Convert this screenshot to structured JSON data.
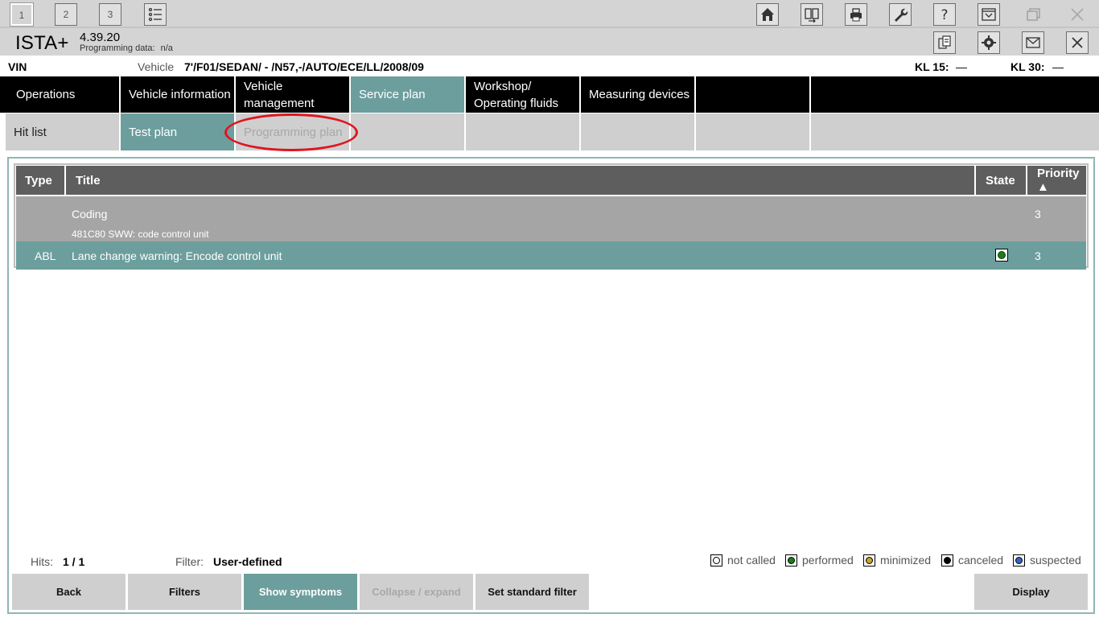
{
  "workspace_tabs": [
    "1",
    "2",
    "3"
  ],
  "toolbar_icons": [
    "list-icon",
    "home-icon",
    "swap-icon",
    "print-icon",
    "wrench-icon",
    "help-icon",
    "minimize-icon",
    "restore-icon",
    "close-icon"
  ],
  "header": {
    "brand": "ISTA+",
    "version": "4.39.20",
    "programming_label": "Programming data:",
    "programming_value": "n/a"
  },
  "vehicle_line": {
    "vin_label": "VIN",
    "vehicle_label": "Vehicle",
    "vehicle_value": "7'/F01/SEDAN/ - /N57,-/AUTO/ECE/LL/2008/09",
    "kl15_label": "KL 15:",
    "kl15_value": "—",
    "kl30_label": "KL 30:",
    "kl30_value": "—"
  },
  "main_nav": [
    "Operations",
    "Vehicle information",
    "Vehicle management",
    "Service plan",
    "Workshop/ Operating fluids",
    "Measuring devices"
  ],
  "main_nav_selected": "Service plan",
  "sub_nav": [
    "Hit list",
    "Test plan",
    "Programming plan"
  ],
  "sub_nav_selected": "Test plan",
  "table": {
    "headers": {
      "type": "Type",
      "title": "Title",
      "state": "State",
      "priority": "Priority ▲"
    },
    "rows": [
      {
        "type": "",
        "title": "Coding",
        "subtitle": "481C80  SWW: code control unit",
        "state": "",
        "priority": "3"
      },
      {
        "type": "ABL",
        "title": "Lane change warning: Encode control unit",
        "subtitle": "",
        "state": "performed",
        "priority": "3"
      }
    ]
  },
  "footer": {
    "hits_label": "Hits:",
    "hits_value": "1 / 1",
    "filter_label": "Filter:",
    "filter_value": "User-defined",
    "legend": {
      "not_called": "not called",
      "performed": "performed",
      "minimized": "minimized",
      "canceled": "canceled",
      "suspected": "suspected"
    },
    "buttons": {
      "back": "Back",
      "filters": "Filters",
      "show_symptoms": "Show symptoms",
      "collapse_expand": "Collapse / expand",
      "set_standard_filter": "Set standard filter",
      "display": "Display"
    }
  },
  "colors": {
    "accent_teal": "#6c9e9d",
    "nav_black": "#000000",
    "performed_green": "#1a7d1a",
    "minimized_gold": "#c9a227",
    "canceled_black": "#000000",
    "suspected_blue": "#3a5fc8",
    "annotation_red": "#e0141e"
  }
}
